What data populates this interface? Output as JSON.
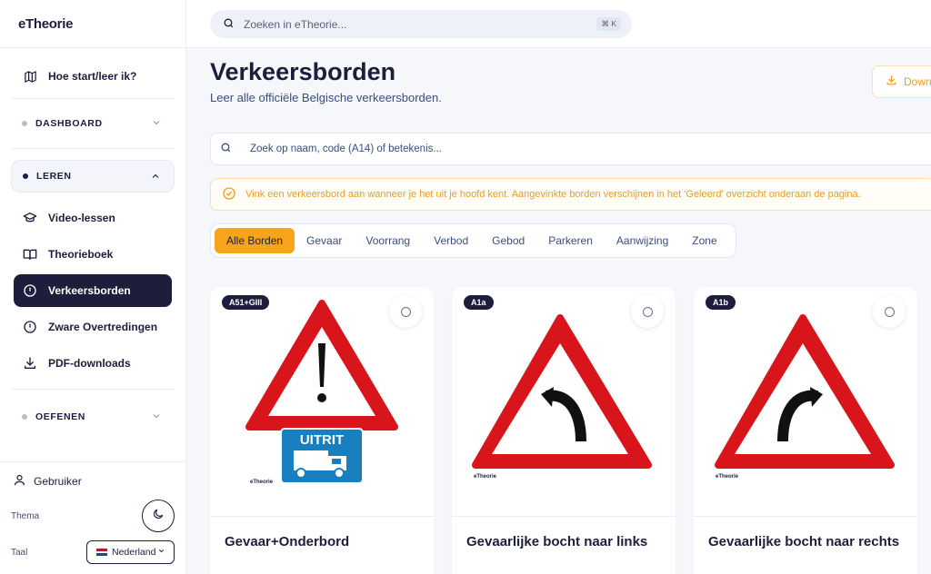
{
  "app": {
    "logo": "eTheorie"
  },
  "sidebar": {
    "how_to": "Hoe start/leer ik?",
    "groups": {
      "dashboard": "DASHBOARD",
      "leren": "LEREN",
      "oefenen": "OEFENEN"
    },
    "items": [
      {
        "label": "Video-lessen",
        "icon": "graduation-cap-icon"
      },
      {
        "label": "Theorieboek",
        "icon": "book-icon"
      },
      {
        "label": "Verkeersborden",
        "icon": "alert-circle-icon",
        "active": true
      },
      {
        "label": "Zware Overtredingen",
        "icon": "alert-circle-icon"
      },
      {
        "label": "PDF-downloads",
        "icon": "download-icon"
      }
    ],
    "user": "Gebruiker",
    "theme_label": "Thema",
    "lang_label": "Taal",
    "lang_value": "Nederland"
  },
  "topbar": {
    "search_placeholder": "Zoeken in eTheorie...",
    "shortcut": "⌘ K"
  },
  "main": {
    "title": "Verkeersborden",
    "subtitle": "Leer alle officiële Belgische verkeersborden.",
    "download_label": "Down",
    "search_placeholder": "Zoek op naam, code (A14) of betekenis...",
    "notice": "Vink een verkeersbord aan wanneer je het uit je hoofd kent. Aangevinkte borden verschijnen in het 'Geleerd' overzicht onderaan de pagina.",
    "filters": [
      "Alle Borden",
      "Gevaar",
      "Voorrang",
      "Verbod",
      "Gebod",
      "Parkeren",
      "Aanwijzing",
      "Zone"
    ],
    "active_filter": "Alle Borden"
  },
  "cards": [
    {
      "code": "A51+GIII",
      "title": "Gevaar+Onderbord",
      "sign": "exclamation",
      "sub_sign_text": "UITRIT",
      "watermark": "eTheorie"
    },
    {
      "code": "A1a",
      "title": "Gevaarlijke bocht naar links",
      "sign": "curve-left",
      "watermark": "eTheorie"
    },
    {
      "code": "A1b",
      "title": "Gevaarlijke bocht naar rechts",
      "sign": "curve-right",
      "watermark": "eTheorie"
    }
  ],
  "colors": {
    "navy": "#1c1e3c",
    "accent": "#f5a41c",
    "sign_red": "#d7151b",
    "sign_blue": "#1a7fbf"
  }
}
